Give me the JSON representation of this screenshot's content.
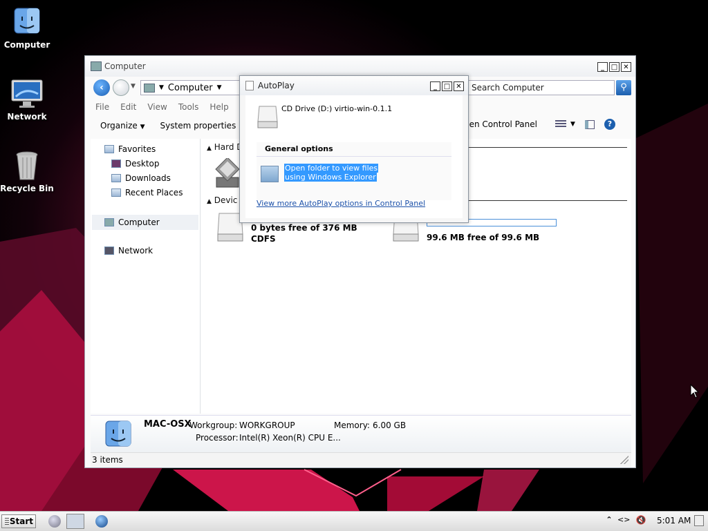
{
  "desktop": {
    "icons": [
      {
        "label": "Computer"
      },
      {
        "label": "Network"
      },
      {
        "label": "Recycle Bin"
      }
    ]
  },
  "explorer": {
    "title": "Computer",
    "address": "Computer",
    "search_placeholder": "Search Computer",
    "menu": [
      "File",
      "Edit",
      "View",
      "Tools",
      "Help"
    ],
    "commands": {
      "organize": "Organize",
      "system_properties": "System properties",
      "open_control_panel": "pen Control Panel"
    },
    "nav": {
      "favorites": "Favorites",
      "desktop": "Desktop",
      "downloads": "Downloads",
      "recent_places": "Recent Places",
      "computer": "Computer",
      "network": "Network"
    },
    "groups": {
      "hard_disks": "Hard D",
      "devices": "Devic"
    },
    "drives": [
      {
        "free": "0 bytes free of 376 MB",
        "fs": "CDFS"
      },
      {
        "name_fragment": ")",
        "free": "99.6 MB free of 99.6 MB"
      }
    ],
    "details": {
      "computer_name": "MAC-OSX",
      "workgroup_label": "Workgroup:",
      "workgroup_value": "WORKGROUP",
      "memory_label": "Memory:",
      "memory_value": "6.00 GB",
      "processor_label": "Processor:",
      "processor_value": "Intel(R) Xeon(R) CPU E..."
    },
    "status": "3 items"
  },
  "autoplay": {
    "title": "AutoPlay",
    "drive_label": "CD Drive (D:) virtio-win-0.1.1",
    "section": "General options",
    "option_line1": "Open folder to view files",
    "option_line2": "using Windows Explorer",
    "more_link": "View more AutoPlay options in Control Panel"
  },
  "taskbar": {
    "start": "Start",
    "clock": "5:01 AM"
  },
  "colors": {
    "accent": "#1c5fae",
    "selection": "#3399ff",
    "desktop_red": "#7a0f2e"
  }
}
